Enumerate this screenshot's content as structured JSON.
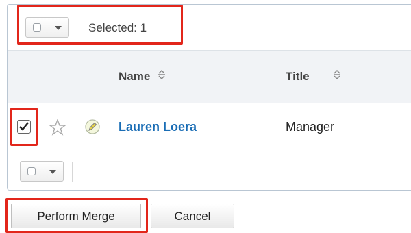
{
  "list_panel": {
    "top_toolbar": {
      "selected_text": "Selected: 1"
    },
    "columns": [
      {
        "label": "Name"
      },
      {
        "label": "Title"
      }
    ],
    "rows": [
      {
        "selected": true,
        "name": "Lauren Loera",
        "title": "Manager"
      }
    ],
    "icons": {
      "dropdown": "chevron-down-icon",
      "sort": "sort-icon",
      "favorite": "star-icon",
      "edit": "pencil-icon",
      "checkbox_checked": "checkbox-checked-icon"
    }
  },
  "actions": {
    "perform_merge_label": "Perform Merge",
    "cancel_label": "Cancel"
  },
  "colors": {
    "highlight": "#e2261b",
    "link": "#1a6db5",
    "header_bg": "#f1f3f6",
    "border": "#b9c6d3"
  }
}
